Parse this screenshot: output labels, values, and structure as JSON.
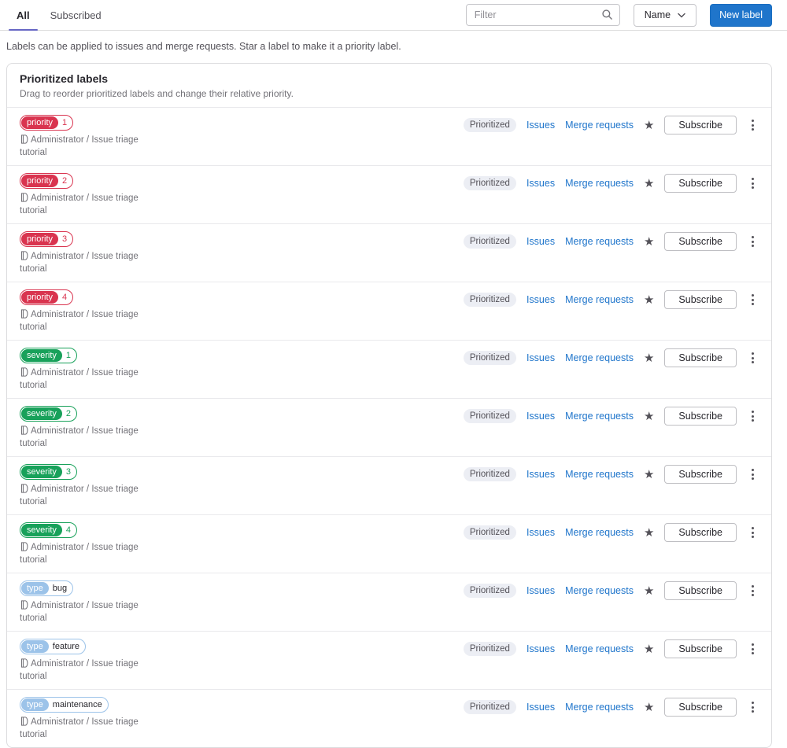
{
  "tabs": [
    {
      "label": "All",
      "active": true
    },
    {
      "label": "Subscribed",
      "active": false
    }
  ],
  "toolbar": {
    "filter_placeholder": "Filter",
    "sort_button": "Name",
    "new_label_button": "New label"
  },
  "page_description": "Labels can be applied to issues and merge requests. Star a label to make it a priority label.",
  "prioritized_card": {
    "title": "Prioritized labels",
    "subtitle": "Drag to reorder prioritized labels and change their relative priority."
  },
  "row_common": {
    "prioritized_badge": "Prioritized",
    "issues_link": "Issues",
    "merge_requests_link": "Merge requests",
    "subscribe_button": "Subscribe",
    "project_path": "Administrator / Issue triage tutorial"
  },
  "labels": [
    {
      "scope": "priority",
      "value": "1",
      "color": "#d9344f",
      "value_text_color": "#d9344f"
    },
    {
      "scope": "priority",
      "value": "2",
      "color": "#d9344f",
      "value_text_color": "#d9344f"
    },
    {
      "scope": "priority",
      "value": "3",
      "color": "#d9344f",
      "value_text_color": "#d9344f"
    },
    {
      "scope": "priority",
      "value": "4",
      "color": "#d9344f",
      "value_text_color": "#d9344f"
    },
    {
      "scope": "severity",
      "value": "1",
      "color": "#18a15a",
      "value_text_color": "#18a15a"
    },
    {
      "scope": "severity",
      "value": "2",
      "color": "#18a15a",
      "value_text_color": "#18a15a"
    },
    {
      "scope": "severity",
      "value": "3",
      "color": "#18a15a",
      "value_text_color": "#18a15a"
    },
    {
      "scope": "severity",
      "value": "4",
      "color": "#18a15a",
      "value_text_color": "#18a15a"
    },
    {
      "scope": "type",
      "value": "bug",
      "color": "#9cc3e9",
      "value_text_color": "#28272d"
    },
    {
      "scope": "type",
      "value": "feature",
      "color": "#9cc3e9",
      "value_text_color": "#28272d"
    },
    {
      "scope": "type",
      "value": "maintenance",
      "color": "#9cc3e9",
      "value_text_color": "#28272d"
    }
  ],
  "colors": {
    "accent_blue": "#1f75cb",
    "link_blue": "#1f75cb",
    "tab_underline_indigo": "#6666c4",
    "priority_red": "#d9344f",
    "severity_green": "#18a15a",
    "type_light_blue": "#9cc3e9",
    "prioritized_badge_bg": "#eceef4"
  }
}
